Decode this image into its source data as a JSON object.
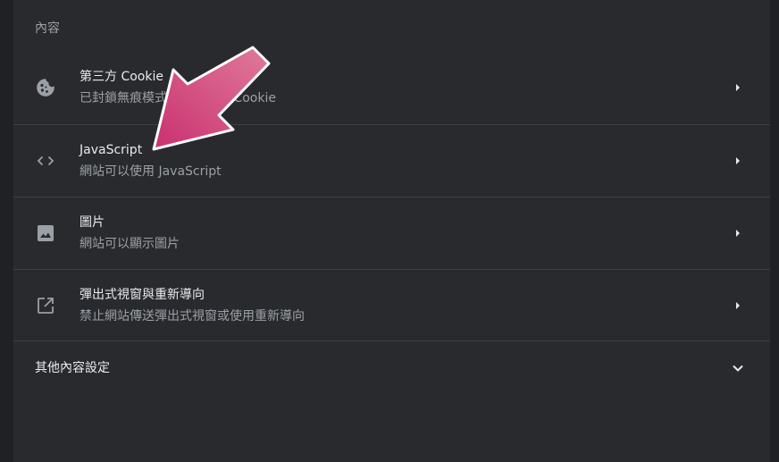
{
  "content": {
    "section_title": "內容",
    "rows": [
      {
        "title": "第三方 Cookie",
        "subtitle": "已封鎖無痕模式中的第三方 Cookie",
        "icon": "cookie-icon"
      },
      {
        "title": "JavaScript",
        "subtitle": "網站可以使用 JavaScript",
        "icon": "code-icon"
      },
      {
        "title": "圖片",
        "subtitle": "網站可以顯示圖片",
        "icon": "image-icon"
      },
      {
        "title": "彈出式視窗與重新導向",
        "subtitle": "禁止網站傳送彈出式視窗或使用重新導向",
        "icon": "open-in-new-icon"
      }
    ],
    "more_label": "其他內容設定"
  },
  "colors": {
    "background": "#202124",
    "card": "#292a2d",
    "text_primary": "#e8eaed",
    "text_secondary": "#9aa0a6",
    "divider": "#3c4043",
    "annotation_arrow": "#d2407a"
  }
}
